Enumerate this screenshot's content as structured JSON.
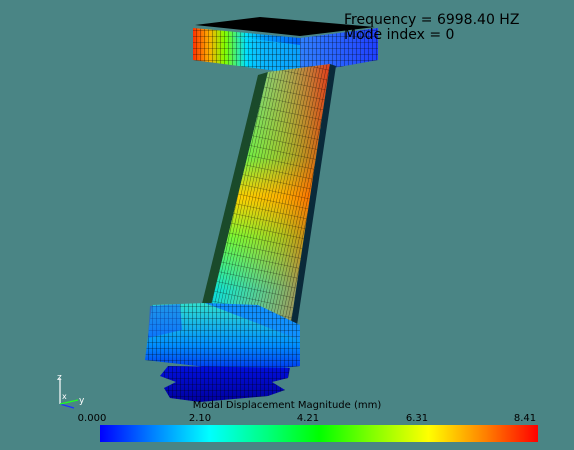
{
  "overlay": {
    "frequency": "Frequency = 6998.40 HZ",
    "mode_index": "Mode index = 0"
  },
  "colorbar": {
    "title": "Modal Displacement Magnitude (mm)",
    "ticks": [
      "0.000",
      "2.10",
      "4.21",
      "6.31",
      "8.41"
    ],
    "min": 0.0,
    "max": 8.41,
    "colormap": [
      "#0000ff",
      "#00ffff",
      "#00ff00",
      "#ffff00",
      "#ff0000"
    ]
  },
  "axes_triad": {
    "x_label": "x",
    "y_label": "y",
    "z_label": "z"
  },
  "colors": {
    "background": "#4a8585",
    "mesh_line": "#000000"
  }
}
